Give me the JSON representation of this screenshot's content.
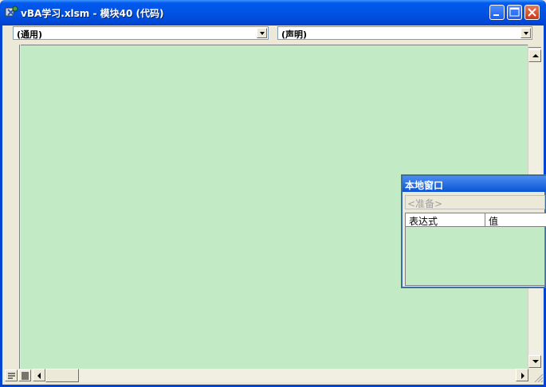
{
  "window": {
    "title": "vBA学习.xlsm - 模块40 (代码)",
    "buttons": [
      "minimize",
      "maximize",
      "close"
    ]
  },
  "toolbar": {
    "object_combo": "(通用)",
    "procedure_combo": "(声明)"
  },
  "editor": {
    "background_color": "#c2eac5",
    "code_lines": []
  },
  "locals_window": {
    "title": "本地窗口",
    "context": "<准备>",
    "columns": [
      "表达式",
      "值"
    ]
  },
  "colors": {
    "titlebar": "#0054e3",
    "frame": "#0046d5",
    "editor_bg": "#c2eac5"
  }
}
